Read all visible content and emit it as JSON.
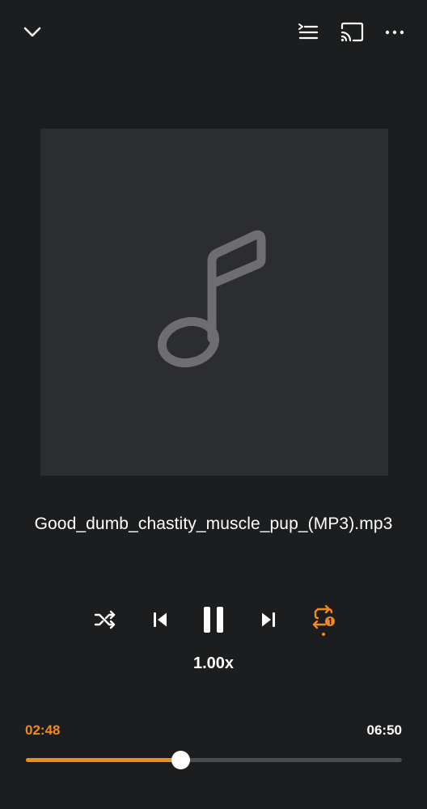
{
  "header": {
    "collapse_icon": "chevron-down-icon",
    "queue_icon": "queue-list-icon",
    "cast_icon": "cast-icon",
    "more_icon": "more-horizontal-icon"
  },
  "artwork": {
    "icon": "music-note-icon"
  },
  "track": {
    "title": "Good_dumb_chastity_muscle_pup_(MP3).mp3"
  },
  "controls": {
    "shuffle_icon": "shuffle-icon",
    "previous_icon": "skip-previous-icon",
    "pause_icon": "pause-icon",
    "next_icon": "skip-next-icon",
    "repeat_icon": "repeat-one-icon",
    "repeat_mode": "one",
    "speed": "1.00x"
  },
  "progress": {
    "elapsed": "02:48",
    "total": "06:50",
    "fraction": 0.41
  },
  "colors": {
    "background": "#1b1d1e",
    "artwork_bg": "#2c2d31",
    "accent": "#f08a1c",
    "icon_gray": "#6e6e70",
    "track_gray": "#4a4b4e"
  }
}
